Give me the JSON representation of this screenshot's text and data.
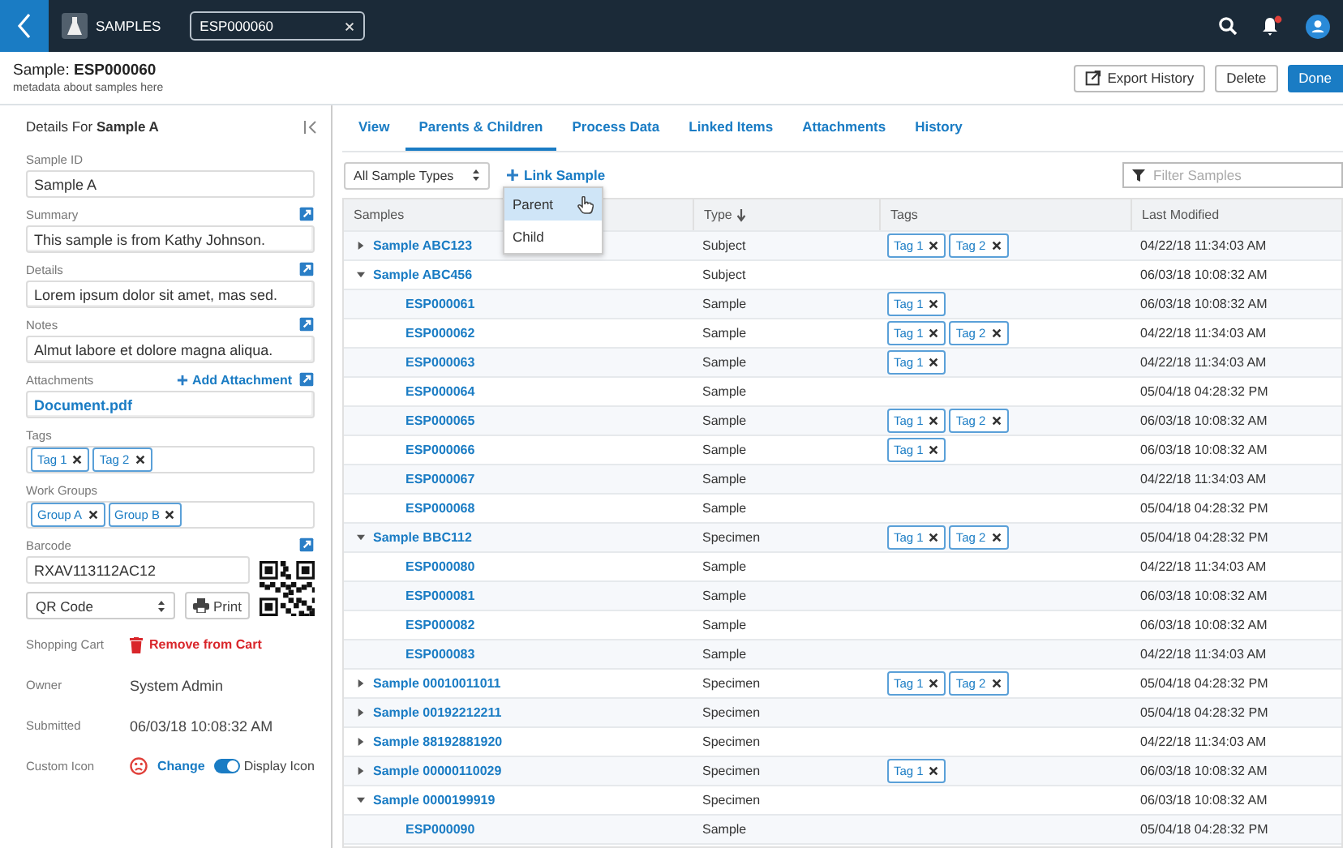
{
  "topbar": {
    "section": "SAMPLES",
    "search_value": "ESP000060"
  },
  "header": {
    "title": "Sample: **ESP000060**",
    "subtitle": "metadata about samples here",
    "buttons": [
      {
        "label": "Export History",
        "kind": "export"
      },
      {
        "label": "Delete",
        "kind": "plain"
      },
      {
        "label": "Done",
        "kind": "primary"
      }
    ]
  },
  "details": {
    "title": "Details For **Sample A**",
    "fields": [
      {
        "kind": "input",
        "label": "Sample ID",
        "value": "Sample A"
      },
      {
        "kind": "textarea",
        "label": "Summary",
        "value": "This sample is from Kathy Johnson."
      },
      {
        "kind": "textarea",
        "label": "Details",
        "value": "Lorem ipsum dolor sit amet, mas sed."
      },
      {
        "kind": "textarea",
        "label": "Notes",
        "value": "Almut labore et dolore magna aliqua."
      },
      {
        "kind": "file",
        "label": "Attachments",
        "action": "Add Attachment",
        "value": "Document.pdf"
      },
      {
        "kind": "chips",
        "label": "Tags",
        "chips": [
          "Tag 1",
          "Tag 2"
        ]
      },
      {
        "kind": "chips",
        "label": "Work Groups",
        "chips": [
          "Group A",
          "Group B"
        ]
      },
      {
        "kind": "barcode",
        "label": "Barcode",
        "value": "RXAV113112AC12",
        "format": "QR Code",
        "print": "Print"
      },
      {
        "kind": "action",
        "label": "Shopping Cart",
        "action": "Remove from Cart"
      },
      {
        "kind": "text",
        "label": "Owner",
        "value": "System Admin"
      },
      {
        "kind": "text",
        "label": "Submitted",
        "value": "06/03/18 10:08:32 AM"
      },
      {
        "kind": "icon",
        "label": "Custom Icon",
        "action": "Change",
        "toggle": {
          "label": "Display Icon",
          "on": true
        }
      }
    ]
  },
  "tabs": [
    {
      "label": "View",
      "selected": false
    },
    {
      "label": "Parents & Children",
      "selected": true
    },
    {
      "label": "Process Data",
      "selected": false
    },
    {
      "label": "Linked Items",
      "selected": false
    },
    {
      "label": "Attachments",
      "selected": false
    },
    {
      "label": "History",
      "selected": false
    }
  ],
  "toolbar": {
    "type_filter": "All Sample Types",
    "link_label": "Link Sample",
    "filter_placeholder": "Filter Samples",
    "menu": [
      {
        "label": "Parent",
        "selected": true
      },
      {
        "label": "Child",
        "selected": false
      }
    ]
  },
  "table": {
    "columns": [
      {
        "label": "Samples",
        "sorted": false
      },
      {
        "label": "Type",
        "sorted": true
      },
      {
        "label": "Tags",
        "sorted": false
      },
      {
        "label": "Last Modified",
        "sorted": false
      }
    ],
    "rows": [
      {
        "name": "Sample ABC123",
        "type": "Subject",
        "tags": [
          "Tag 1",
          "Tag 2"
        ],
        "modified": "04/22/18 11:34:03 AM",
        "expanded": false
      },
      {
        "name": "Sample ABC456",
        "type": "Subject",
        "modified": "06/03/18 10:08:32 AM",
        "expanded": true,
        "children": [
          {
            "name": "ESP000061",
            "type": "Sample",
            "tags": [
              "Tag 1"
            ],
            "modified": "06/03/18 10:08:32 AM"
          },
          {
            "name": "ESP000062",
            "type": "Sample",
            "tags": [
              "Tag 1",
              "Tag 2"
            ],
            "modified": "04/22/18 11:34:03 AM"
          },
          {
            "name": "ESP000063",
            "type": "Sample",
            "tags": [
              "Tag 1"
            ],
            "modified": "04/22/18 11:34:03 AM"
          },
          {
            "name": "ESP000064",
            "type": "Sample",
            "modified": "05/04/18 04:28:32 PM"
          },
          {
            "name": "ESP000065",
            "type": "Sample",
            "tags": [
              "Tag 1",
              "Tag 2"
            ],
            "modified": "06/03/18 10:08:32 AM"
          },
          {
            "name": "ESP000066",
            "type": "Sample",
            "tags": [
              "Tag 1"
            ],
            "modified": "06/03/18 10:08:32 AM"
          },
          {
            "name": "ESP000067",
            "type": "Sample",
            "modified": "04/22/18 11:34:03 AM"
          },
          {
            "name": "ESP000068",
            "type": "Sample",
            "modified": "05/04/18 04:28:32 PM"
          }
        ]
      },
      {
        "name": "Sample BBC112",
        "type": "Specimen",
        "tags": [
          "Tag 1",
          "Tag 2"
        ],
        "modified": "05/04/18 04:28:32 PM",
        "expanded": true,
        "children": [
          {
            "name": "ESP000080",
            "type": "Sample",
            "modified": "04/22/18 11:34:03 AM"
          },
          {
            "name": "ESP000081",
            "type": "Sample",
            "modified": "06/03/18 10:08:32 AM"
          },
          {
            "name": "ESP000082",
            "type": "Sample",
            "modified": "06/03/18 10:08:32 AM"
          },
          {
            "name": "ESP000083",
            "type": "Sample",
            "modified": "04/22/18 11:34:03 AM"
          }
        ]
      },
      {
        "name": "Sample 00010011011",
        "type": "Specimen",
        "tags": [
          "Tag 1",
          "Tag 2"
        ],
        "modified": "05/04/18 04:28:32 PM",
        "expanded": false
      },
      {
        "name": "Sample 00192212211",
        "type": "Specimen",
        "modified": "05/04/18 04:28:32 PM",
        "expanded": false
      },
      {
        "name": "Sample 88192881920",
        "type": "Specimen",
        "modified": "04/22/18 11:34:03 AM",
        "expanded": false
      },
      {
        "name": "Sample 00000110029",
        "type": "Specimen",
        "tags": [
          "Tag 1"
        ],
        "modified": "06/03/18 10:08:32 AM",
        "expanded": false
      },
      {
        "name": "Sample 0000199919",
        "type": "Specimen",
        "modified": "06/03/18 10:08:32 AM",
        "expanded": true,
        "children": [
          {
            "name": "ESP000090",
            "type": "Sample",
            "modified": "05/04/18 04:28:32 PM"
          }
        ]
      }
    ]
  }
}
